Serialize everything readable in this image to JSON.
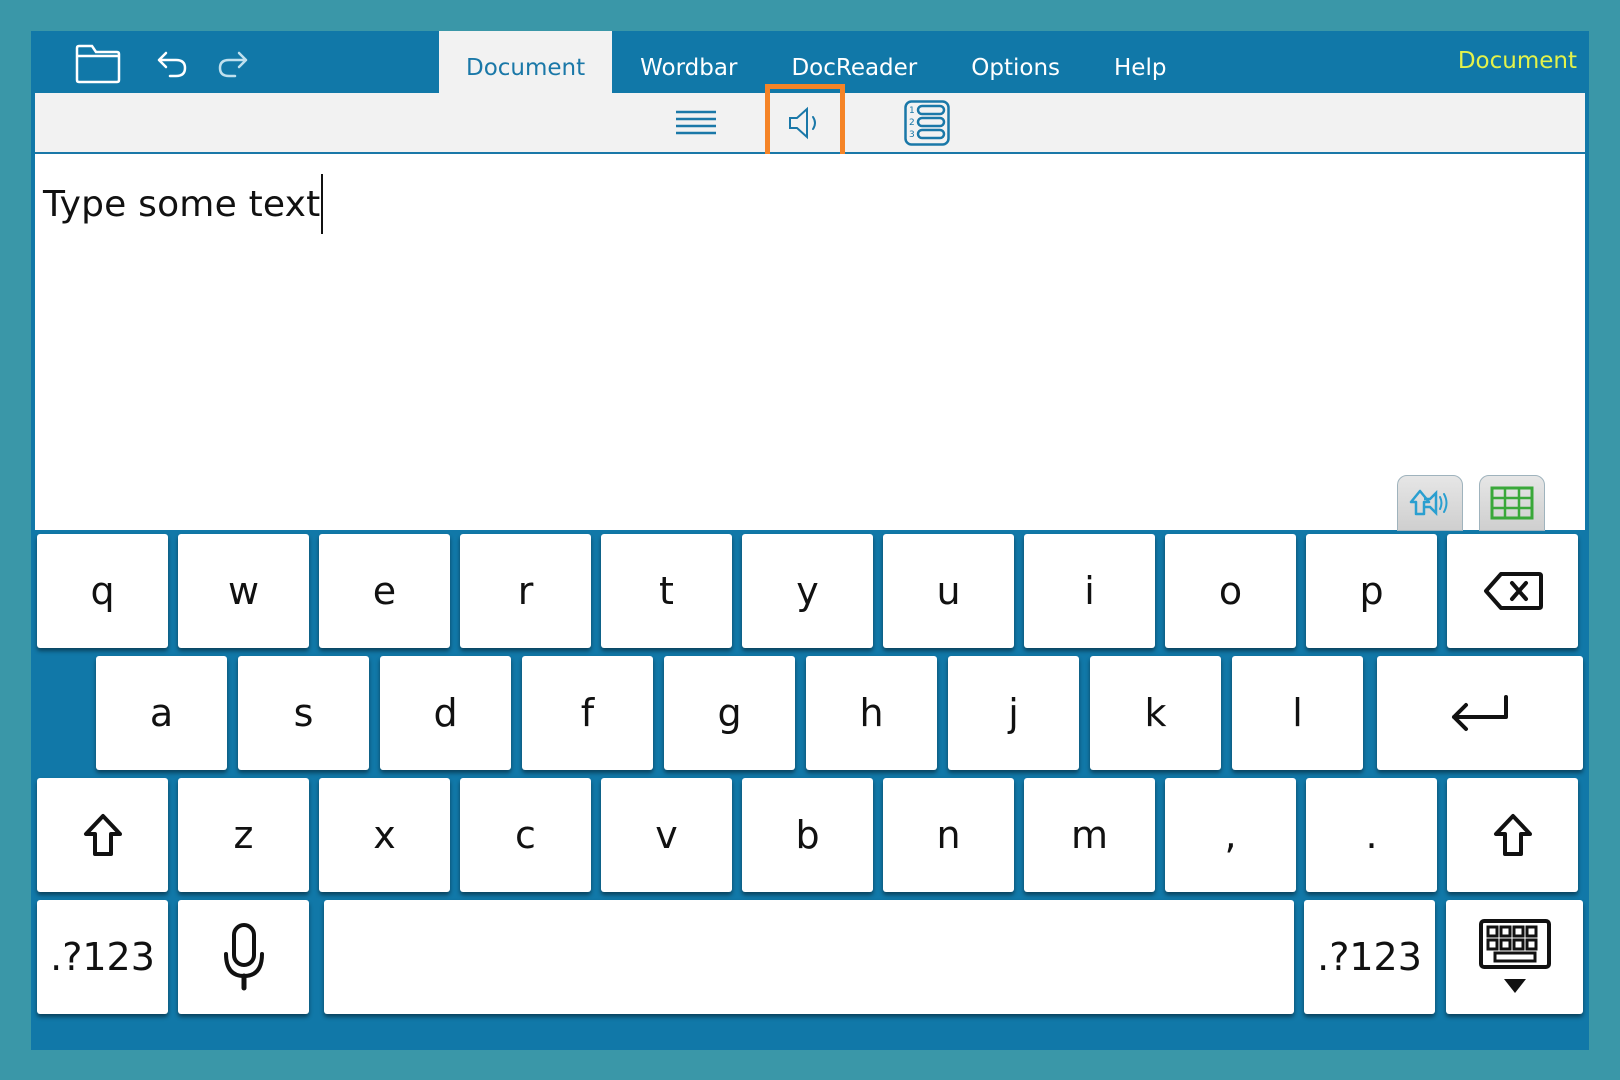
{
  "topbar": {
    "tabs": [
      {
        "label": "Document",
        "active": true
      },
      {
        "label": "Wordbar",
        "active": false
      },
      {
        "label": "DocReader",
        "active": false
      },
      {
        "label": "Options",
        "active": false
      },
      {
        "label": "Help",
        "active": false
      }
    ],
    "mode_label": "Document",
    "icons": [
      "folder-icon",
      "undo-icon",
      "redo-icon"
    ]
  },
  "toolbar": {
    "icons": [
      "text-lines-icon",
      "speaker-icon",
      "numbered-list-icon"
    ],
    "highlighted": "speaker-icon",
    "highlight_color": "#f58427"
  },
  "document": {
    "text": "Type some text",
    "buttons": [
      "speak-shift-icon",
      "grid-icon"
    ]
  },
  "keyboard": {
    "row1": [
      "q",
      "w",
      "e",
      "r",
      "t",
      "y",
      "u",
      "i",
      "o",
      "p"
    ],
    "row2": [
      "a",
      "s",
      "d",
      "f",
      "g",
      "h",
      "j",
      "k",
      "l"
    ],
    "row3": [
      "z",
      "x",
      "c",
      "v",
      "b",
      "n",
      "m",
      ",",
      "."
    ],
    "numeric_label_left": ".?123",
    "numeric_label_right": ".?123",
    "special_icons": [
      "backspace-icon",
      "return-icon",
      "shift-icon",
      "microphone-icon",
      "keyboard-hide-icon"
    ]
  },
  "colors": {
    "frame": "#3a97a8",
    "app": "#1178a8",
    "accent_text": "#e4f24a",
    "active_tab_text": "#1a78a8"
  }
}
